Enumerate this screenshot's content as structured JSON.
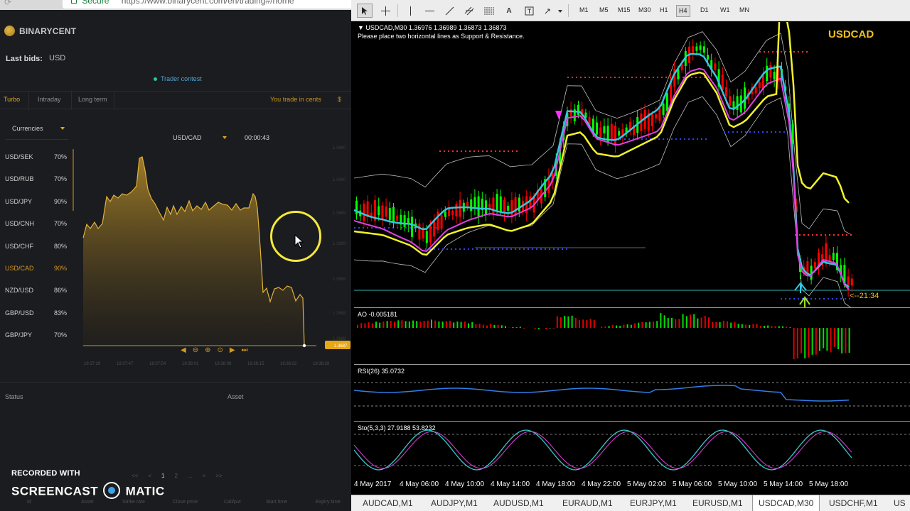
{
  "browser": {
    "secure_label": "Secure",
    "url": "https://www.binarycent.com/en/trading#/home"
  },
  "brand": {
    "name": "BINARYCENT"
  },
  "last_bids": {
    "label": "Last bids:",
    "value": "USD"
  },
  "trader_contest": "Trader contest",
  "tabs": [
    "Turbo",
    "Intraday",
    "Long term"
  ],
  "cents_notice": "You trade in cents",
  "cents_symbol": "$",
  "currency_select": "Currencies",
  "pair_select": "USD/CAD",
  "countdown": "00:00:43",
  "assets": [
    {
      "name": "USD/SEK",
      "pct": "70%"
    },
    {
      "name": "USD/RUB",
      "pct": "70%"
    },
    {
      "name": "USD/JPY",
      "pct": "90%"
    },
    {
      "name": "USD/CNH",
      "pct": "70%"
    },
    {
      "name": "USD/CHF",
      "pct": "80%"
    },
    {
      "name": "USD/CAD",
      "pct": "90%",
      "active": true
    },
    {
      "name": "NZD/USD",
      "pct": "86%"
    },
    {
      "name": "GBP/USD",
      "pct": "83%"
    },
    {
      "name": "GBP/JPY",
      "pct": "70%"
    }
  ],
  "price_time_ticks": [
    "18:37:29",
    "18:37:47",
    "18:37:54",
    "18:38:01",
    "18:38:08",
    "18:38:15",
    "18:38:22",
    "18:38:28"
  ],
  "price_scale_ticks": [
    "1.3690",
    "1.3690",
    "1.3689",
    "1.3689",
    "1.3688",
    "1.3688",
    "1.3688"
  ],
  "current_price_tag": "1.3687",
  "chart_controls": [
    "◀",
    "⊖",
    "⊕",
    "⊙",
    "▶",
    "⏭"
  ],
  "history": {
    "status_label": "Status",
    "asset_label": "Asset",
    "pager": [
      "<<",
      "<",
      "1",
      "2",
      "...",
      ">",
      ">>"
    ],
    "current_page": "1",
    "columns": [
      "Id",
      "Asset",
      "Strike rate",
      "Close price",
      "Call/put",
      "Start time",
      "Expiry time"
    ]
  },
  "watermark": {
    "line1": "RECORDED WITH",
    "line2a": "SCREENCAST",
    "line2b": "MATIC"
  },
  "mt4": {
    "timeframes": [
      "M1",
      "M5",
      "M15",
      "M30",
      "H1",
      "H4",
      "D1",
      "W1",
      "MN"
    ],
    "active_timeframe": "M30",
    "chart_title": "▼ USDCAD,M30  1.36976 1.36989 1.36873 1.36873",
    "chart_note": "Please place two horizontal lines as Support & Resistance.",
    "symbol": "USDCAD",
    "bar_timer": "<--21:34",
    "ao_label": "AO -0.005181",
    "rsi_label": "RSI(26) 35.0732",
    "sto_label": "Sto(5,3,3) 27.9188 53.8232",
    "date_ticks": [
      "4 May 2017",
      "4 May 06:00",
      "4 May 10:00",
      "4 May 14:00",
      "4 May 18:00",
      "4 May 22:00",
      "5 May 02:00",
      "5 May 06:00",
      "5 May 10:00",
      "5 May 14:00",
      "5 May 18:00"
    ],
    "symbol_tabs": [
      "AUDCAD,M1",
      "AUDJPY,M1",
      "AUDUSD,M1",
      "EURAUD,M1",
      "EURJPY,M1",
      "EURUSD,M1",
      "USDCAD,M30",
      "USDCHF,M1",
      "US"
    ],
    "active_symbol_tab": "USDCAD,M30",
    "colors": {
      "bull": "#00ff00",
      "bear": "#ff0000",
      "ma_fast": "#33c6e0",
      "ma_mid": "#e040e0",
      "ma_slow": "#f2f22a",
      "bands": "#bfbfbf",
      "accent": "#f0c020"
    }
  }
}
